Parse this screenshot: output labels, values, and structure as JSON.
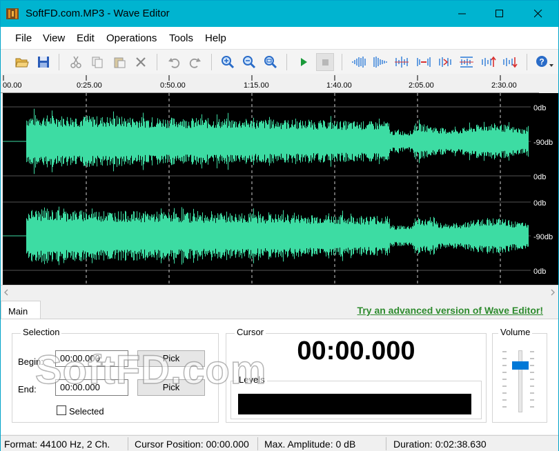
{
  "window": {
    "title": "SoftFD.com.MP3 - Wave Editor"
  },
  "menu": [
    "File",
    "View",
    "Edit",
    "Operations",
    "Tools",
    "Help"
  ],
  "toolbar": {
    "icons": [
      "open-folder-icon",
      "save-icon",
      "cut-icon",
      "copy-icon",
      "paste-icon",
      "delete-icon",
      "undo-icon",
      "redo-icon",
      "zoom-in-icon",
      "zoom-out-icon",
      "zoom-fit-icon",
      "play-icon",
      "stop-icon",
      "fade-in-icon",
      "fade-out-icon",
      "normalize-icon",
      "silence-icon",
      "insert-silence-icon",
      "reverse-icon",
      "amplify-up-icon",
      "amplify-down-icon",
      "help-icon"
    ]
  },
  "timeline": {
    "ticks": [
      "00.00",
      "0:25.00",
      "0:50.00",
      "1:15.00",
      "1:40.00",
      "2:05.00",
      "2:30.00"
    ]
  },
  "db_scale": {
    "top": "0db",
    "mid": "-90db",
    "bottom": "0db"
  },
  "colors": {
    "wave": "#3ddca3",
    "titlebar": "#00b4d0",
    "link": "#2e8b2e",
    "volume_thumb": "#0078d7"
  },
  "tabs": {
    "main": "Main"
  },
  "promo": "Try an advanced version of Wave Editor!",
  "selection": {
    "label": "Selection",
    "begin_label": "Begin:",
    "begin_value": "00:00.000",
    "end_label": "End:",
    "end_value": "00:00.000",
    "pick_label": "Pick",
    "selected_label": "Selected",
    "selected_checked": false
  },
  "cursor": {
    "label": "Cursor",
    "time": "00:00.000"
  },
  "levels": {
    "label": "Levels"
  },
  "volume": {
    "label": "Volume",
    "level": 0.8
  },
  "watermark": "SoftFD.com",
  "status": {
    "format": "Format: 44100 Hz, 2 Ch.",
    "cursor_position": "Cursor Position: 00:00.000",
    "max_amplitude": "Max. Amplitude: 0 dB",
    "duration": "Duration: 0:02:38.630"
  }
}
